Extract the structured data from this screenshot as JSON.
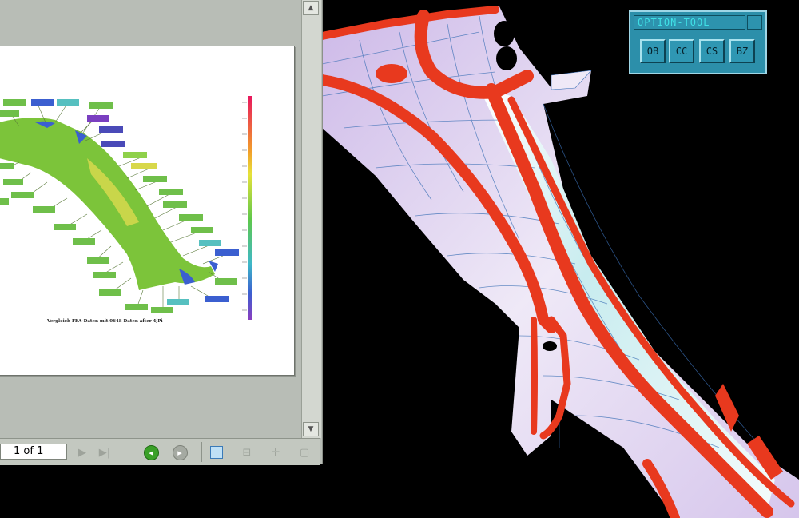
{
  "viewer": {
    "page_field": "1 of 1",
    "page_caption": "Vergleich FEA-Daten mit 0648 Daten after 4jPi",
    "icons": {
      "scroll_up": "triangle-up",
      "scroll_down": "triangle-down",
      "next_page": "next-page-icon",
      "last_page": "last-page-icon",
      "go_back": "go-back-icon",
      "go_forward": "go-forward-icon",
      "single_page": "single-page-view-icon",
      "fit_width": "fit-width-icon",
      "fit_page": "fit-page-icon",
      "continuous": "continuous-view-icon"
    }
  },
  "option_toolbox": {
    "title": "OPTION-TOOL",
    "buttons": [
      "OB",
      "CC",
      "CS",
      "BZ"
    ]
  },
  "colors": {
    "background": "#000000",
    "viewer_gray": "#b8bdb6",
    "toolbox_teal": "#2c8faa",
    "part_red": "#e8391e",
    "part_lavender": "#d9c8ec"
  }
}
